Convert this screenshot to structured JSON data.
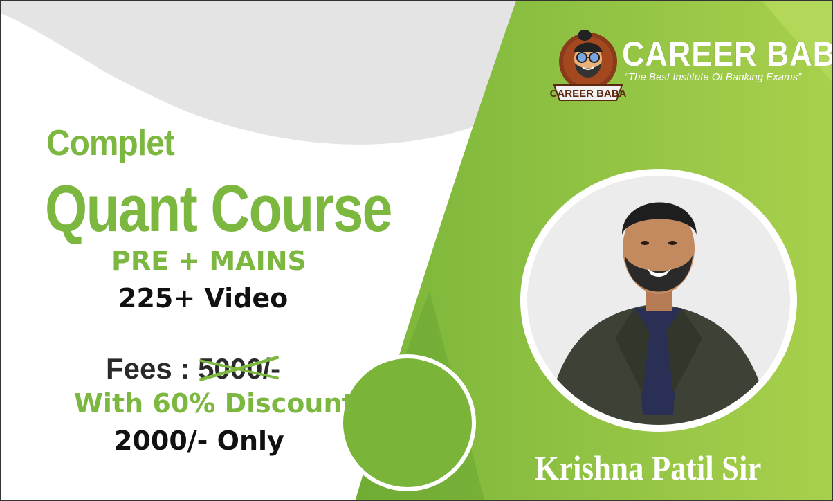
{
  "heading": {
    "line1": "Complet",
    "line2": "Quant Course",
    "subtitle": "PRE + MAINS",
    "videos": "225+ Video"
  },
  "pricing": {
    "fees_label": "Fees : ",
    "original_price": "5000/-",
    "discount": "With 60% Discount",
    "final_price": "2000/- Only"
  },
  "brand": {
    "name": "CAREER BABA",
    "tagline": "“The Best Institute Of Banking Exams”",
    "logo_text": "CAREER BABA"
  },
  "teacher": {
    "name": "Krishna Patil Sir"
  },
  "colors": {
    "accent_green": "#7cb740",
    "dark_green": "#6aa532",
    "light_green": "#a6d04a",
    "grey": "#e6e6e6"
  },
  "icons": [
    "career-baba-logo-icon",
    "teacher-photo"
  ]
}
